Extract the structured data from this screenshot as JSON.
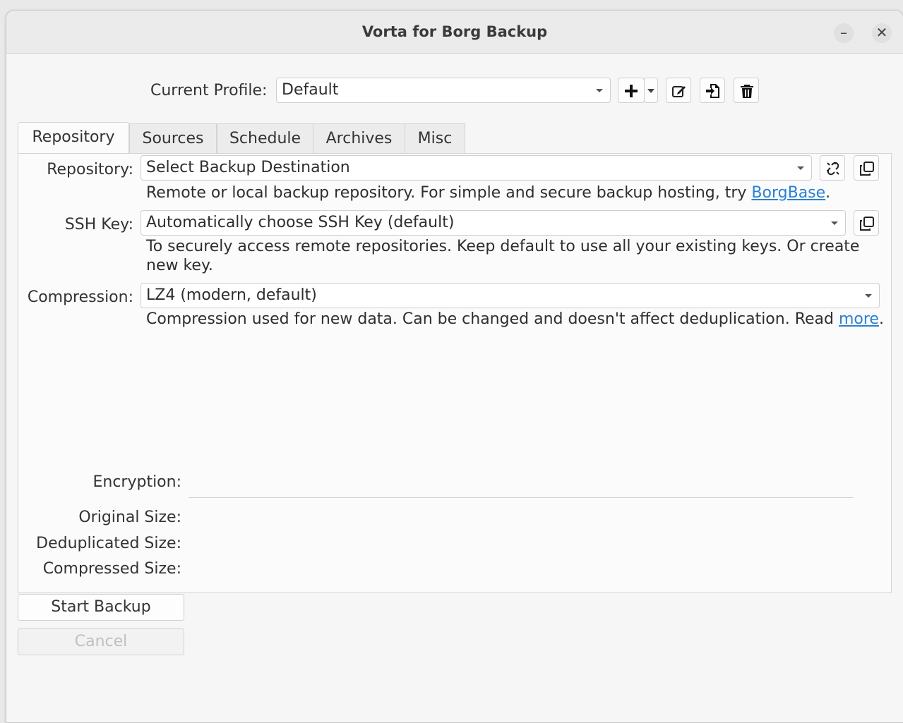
{
  "window": {
    "title": "Vorta for Borg Backup"
  },
  "profile": {
    "label": "Current Profile:",
    "value": "Default"
  },
  "toolbar_icons": [
    "add-icon",
    "dropdown-icon",
    "edit-icon",
    "import-icon",
    "trash-icon"
  ],
  "tabs": [
    {
      "label": "Repository",
      "active": true
    },
    {
      "label": "Sources"
    },
    {
      "label": "Schedule"
    },
    {
      "label": "Archives"
    },
    {
      "label": "Misc"
    }
  ],
  "repository": {
    "label": "Repository:",
    "value": "Select Backup Destination",
    "help_prefix": "Remote or local backup repository. For simple and secure backup hosting, try ",
    "help_link": "BorgBase",
    "help_suffix": "."
  },
  "ssh_key": {
    "label": "SSH Key:",
    "value": "Automatically choose SSH Key (default)",
    "help_line1": "To securely access remote repositories. Keep default to use all your existing keys. Or create",
    "help_line2": "new key."
  },
  "compression": {
    "label": "Compression:",
    "value": "LZ4 (modern, default)",
    "help_prefix": "Compression used for new data. Can be changed and doesn't affect deduplication. Read ",
    "help_link": "more",
    "help_suffix": "."
  },
  "stats": {
    "encryption": "Encryption:",
    "original_size": "Original Size:",
    "deduplicated_size": "Deduplicated Size:",
    "compressed_size": "Compressed Size:"
  },
  "buttons": {
    "start": "Start Backup",
    "cancel": "Cancel"
  }
}
